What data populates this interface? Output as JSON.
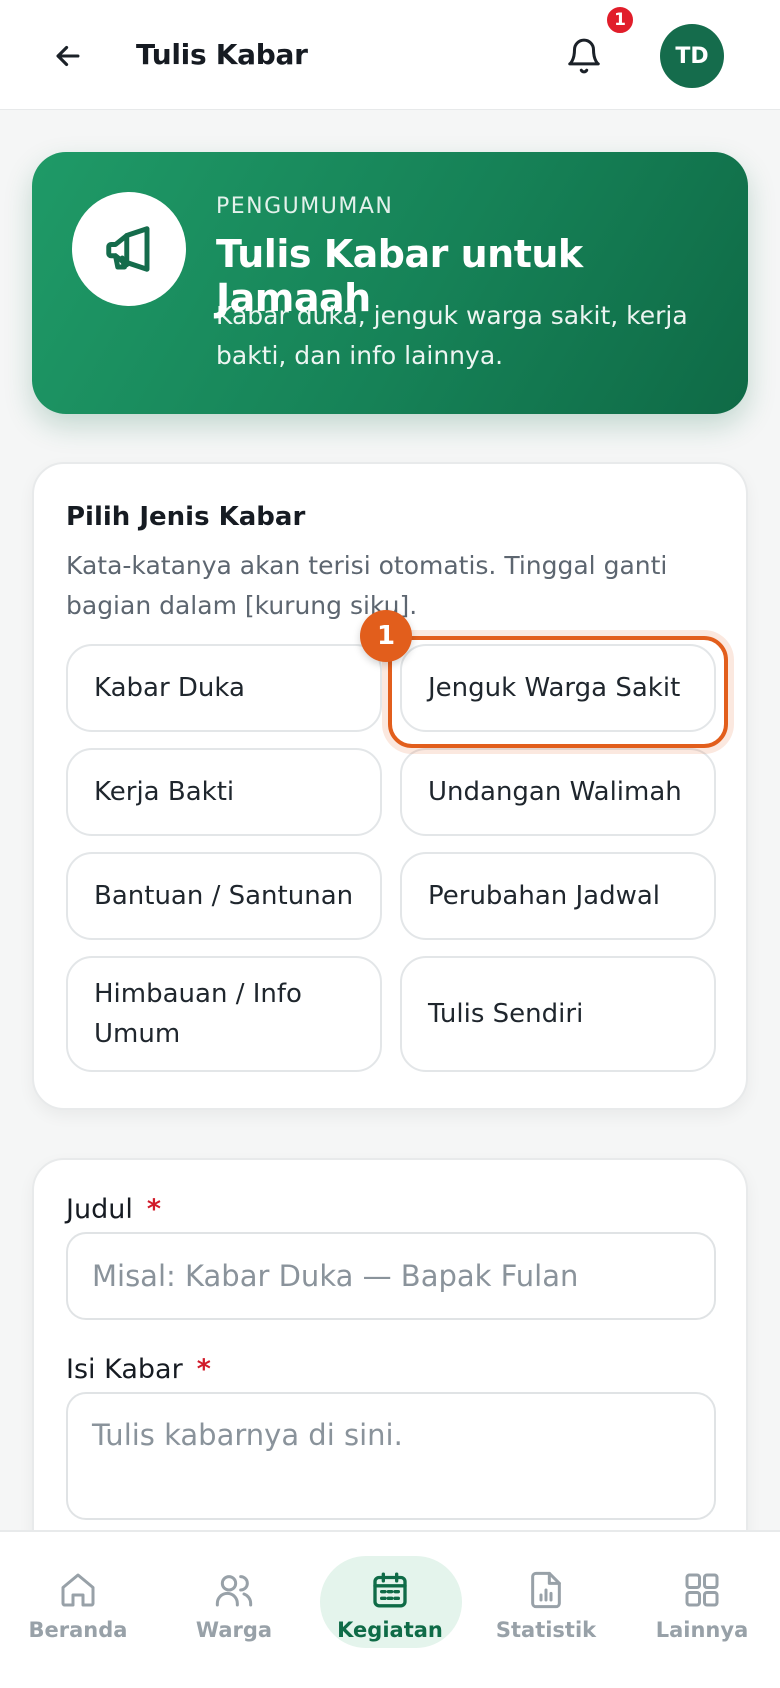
{
  "header": {
    "title": "Tulis Kabar",
    "notification_count": "1",
    "avatar_initials": "TD"
  },
  "hero": {
    "eyebrow": "PENGUMUMAN",
    "title": "Tulis Kabar untuk Jamaah",
    "description": "Kabar duka, jenguk warga sakit, kerja bakti, dan info lainnya.",
    "icon": "megaphone-icon"
  },
  "types": {
    "title": "Pilih Jenis Kabar",
    "subtitle": "Kata-katanya akan terisi otomatis. Tinggal ganti bagian dalam [kurung siku].",
    "marker": "1",
    "options": [
      {
        "label": "Kabar Duka"
      },
      {
        "label": "Jenguk Warga Sakit"
      },
      {
        "label": "Kerja Bakti"
      },
      {
        "label": "Undangan Walimah"
      },
      {
        "label": "Bantuan / Santunan"
      },
      {
        "label": "Perubahan Jadwal"
      },
      {
        "label": "Himbauan / Info Umum"
      },
      {
        "label": "Tulis Sendiri"
      }
    ]
  },
  "form": {
    "title_label": "Judul",
    "title_placeholder": "Misal: Kabar Duka — Bapak Fulan",
    "title_value": "",
    "body_label": "Isi Kabar",
    "body_placeholder": "Tulis kabarnya di sini.",
    "body_value": "",
    "required_mark": "*"
  },
  "nav": {
    "items": [
      {
        "label": "Beranda",
        "icon": "home-icon"
      },
      {
        "label": "Warga",
        "icon": "users-icon"
      },
      {
        "label": "Kegiatan",
        "icon": "calendar-icon"
      },
      {
        "label": "Statistik",
        "icon": "chart-icon"
      },
      {
        "label": "Lainnya",
        "icon": "grid-icon"
      }
    ],
    "active": "Kegiatan"
  },
  "colors": {
    "brand": "#168257",
    "brand_dark": "#0f6b47",
    "highlight": "#e25e1c",
    "badge": "#e11d2a"
  }
}
